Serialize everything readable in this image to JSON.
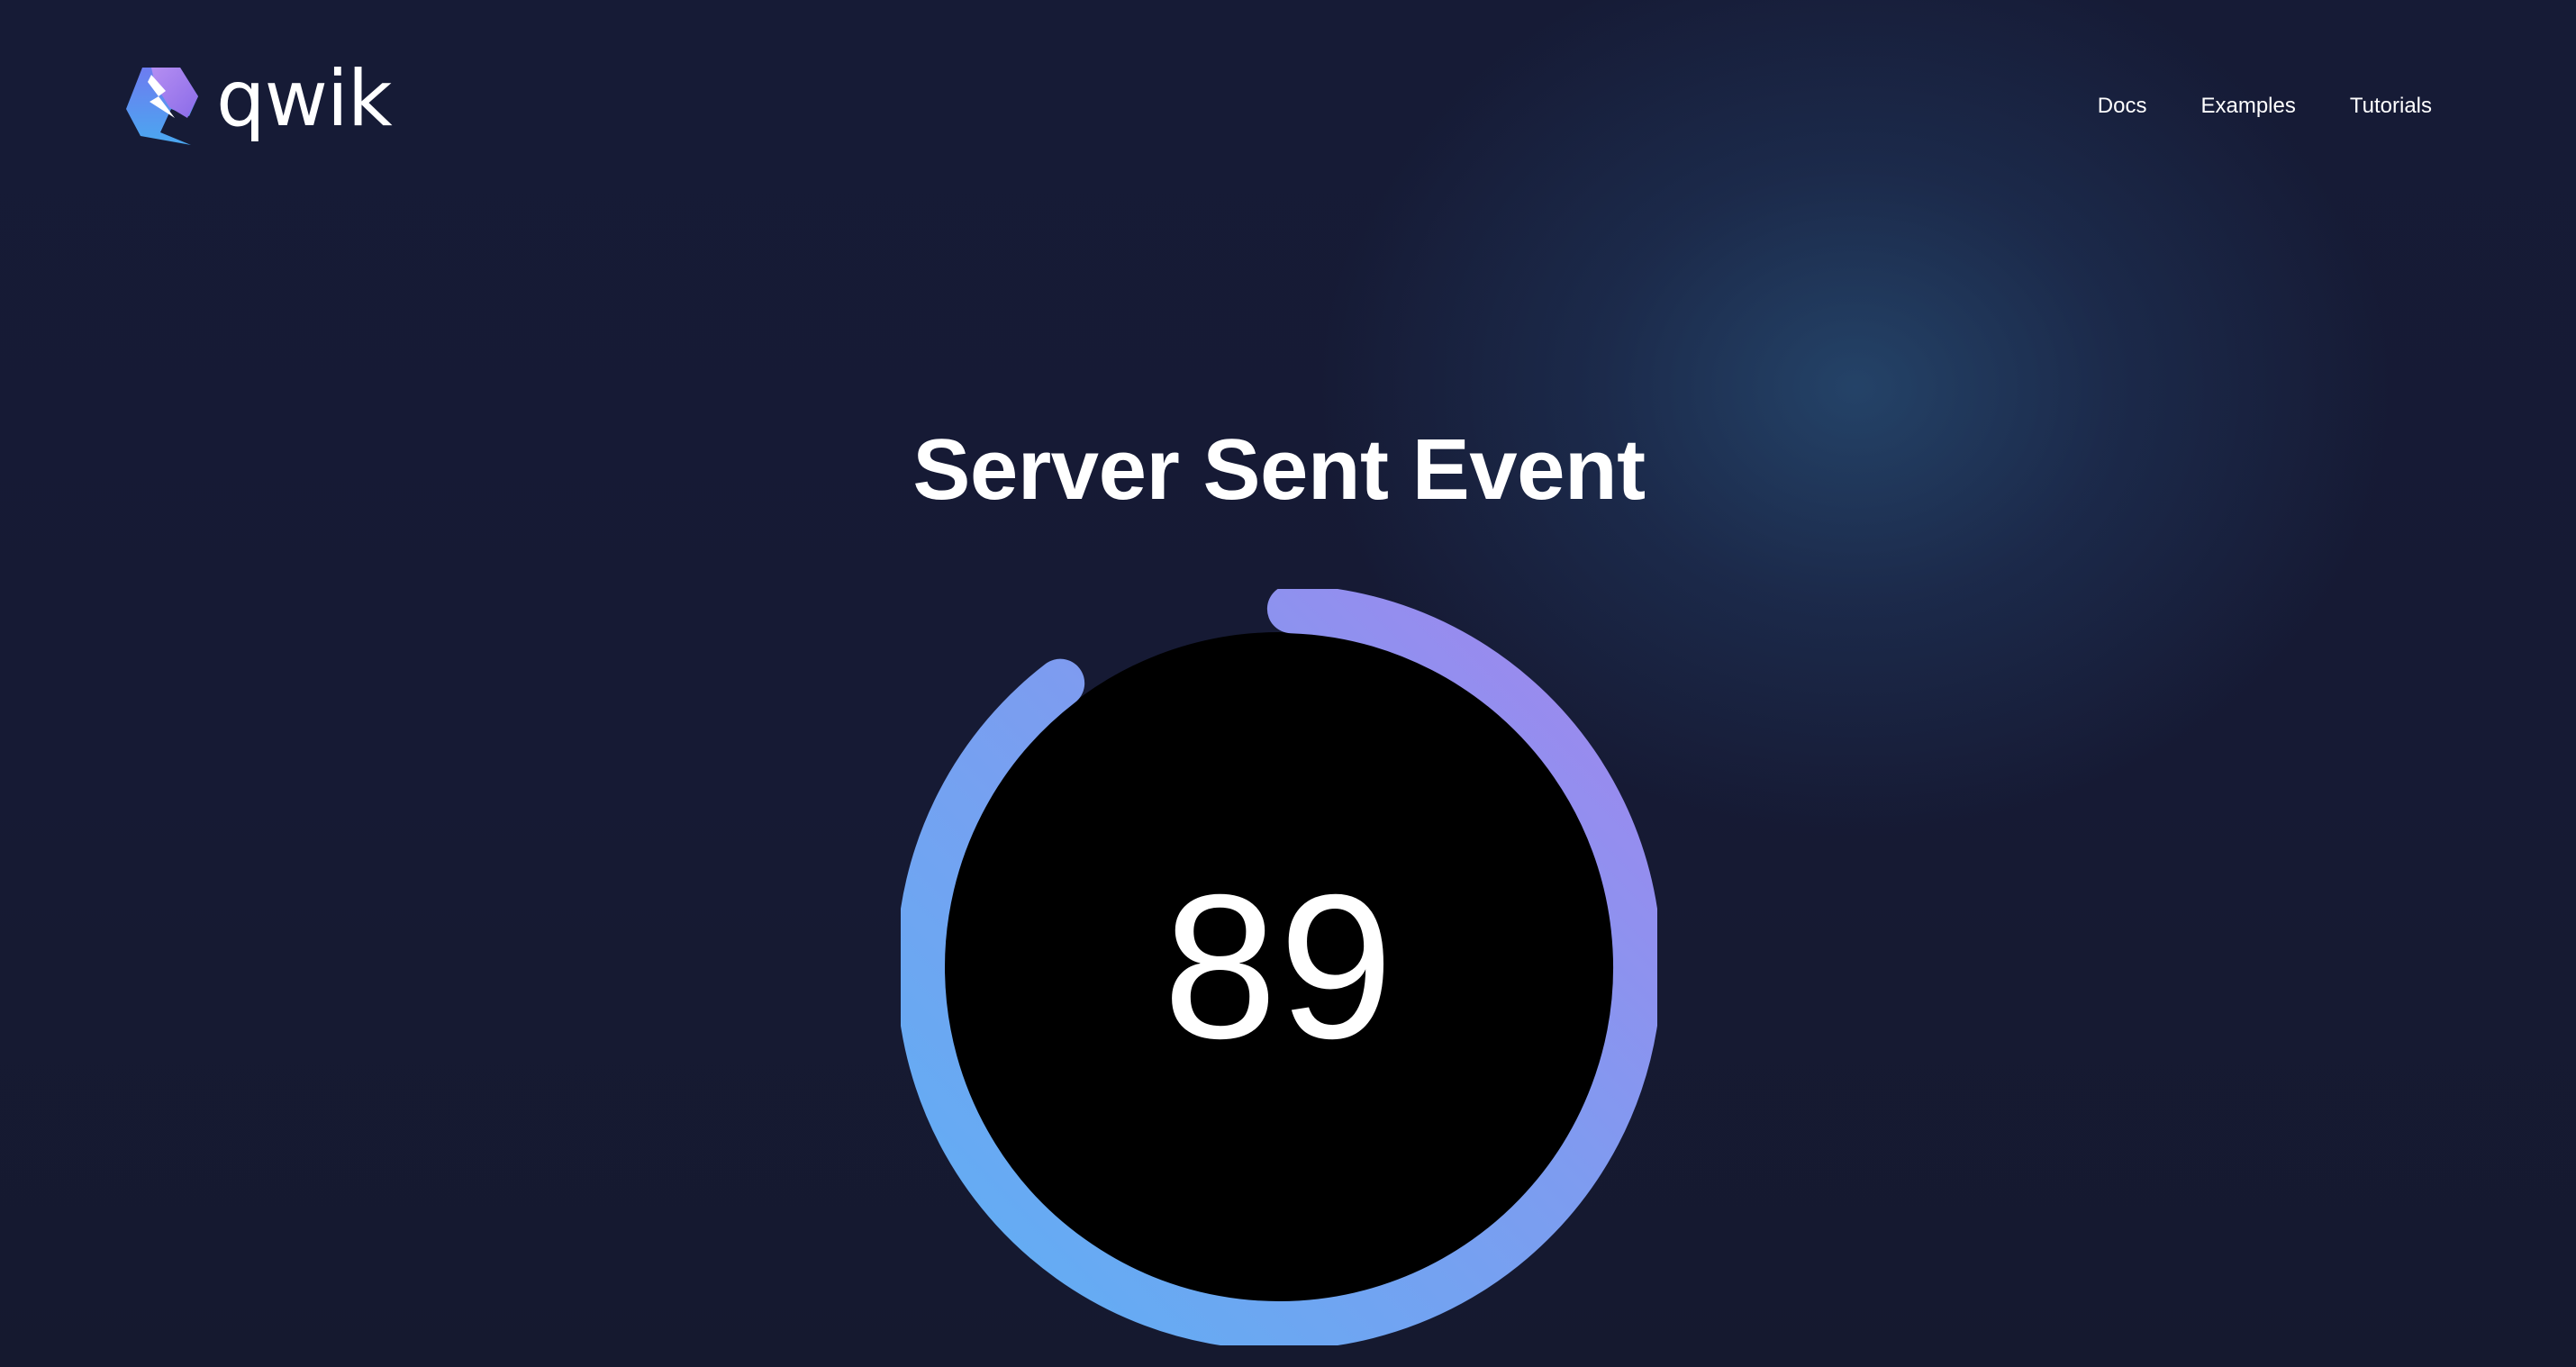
{
  "app": {
    "brand": "qwik"
  },
  "nav": {
    "items": [
      {
        "label": "Docs"
      },
      {
        "label": "Examples"
      },
      {
        "label": "Tutorials"
      }
    ]
  },
  "main": {
    "title": "Server Sent Event",
    "gauge": {
      "value": "89",
      "progress_percent": 89
    }
  },
  "colors": {
    "background": "#151932",
    "glow": "#284e76",
    "gauge_fill": "#000000",
    "gauge_gradient_start": "#5eabf2",
    "gauge_gradient_end": "#9a86ef",
    "text": "#ffffff"
  },
  "icons": {
    "logo": "qwik-logo-icon"
  }
}
